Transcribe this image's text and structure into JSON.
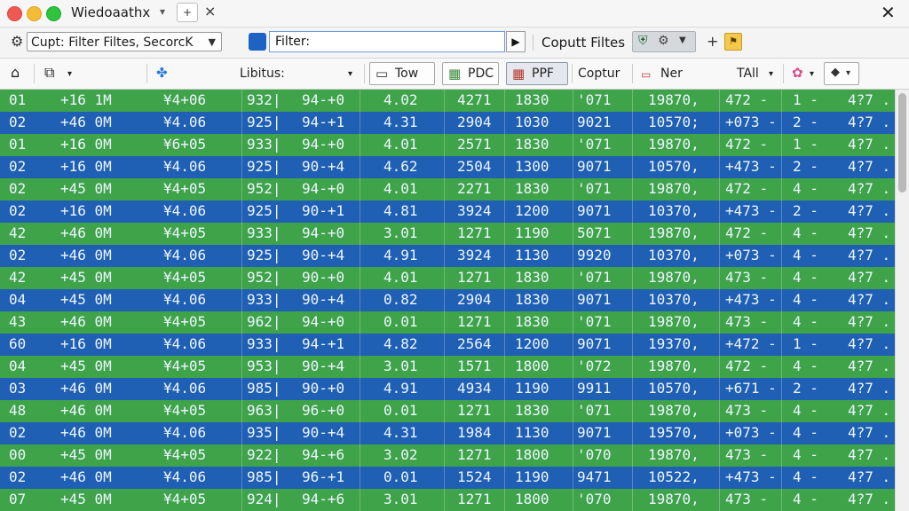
{
  "titlebar": {
    "app_title": "Wiedoaathx",
    "tab_caret": "▾",
    "tab_add": "+",
    "tab_close": "×",
    "window_close": "✕"
  },
  "filterbar": {
    "preset_value": "Cupt: Filter Filtes, SecorcK",
    "filter_value": "Filter:",
    "go_glyph": "▶",
    "output_label": "Coputt Filtes",
    "plus_glyph": "+",
    "star_glyph": "⚑"
  },
  "columns": {
    "home": "⌂",
    "copy": "⧉",
    "listus": "Libitus:",
    "tow": "Tow",
    "pdc": "PDC",
    "ppf": "PPF",
    "coptur": "Coptur",
    "ner": "Ner",
    "tall": "TAll",
    "caret": "▾"
  },
  "rows": [
    [
      "01",
      "+16 1M",
      "¥4+06",
      "932|",
      "94-+0",
      "4.02",
      "4271",
      "1830",
      "'071",
      "19870,",
      "472 -",
      "1 -",
      "4?7 ."
    ],
    [
      "02",
      "+46 0M",
      "¥4.06",
      "925|",
      "94-+1",
      "4.31",
      "2904",
      "1030",
      "9021",
      "10570;",
      "+073 -",
      "2 -",
      "4?7 ."
    ],
    [
      "01",
      "+16 0M",
      "¥6+05",
      "933|",
      "94-+0",
      "4.01",
      "2571",
      "1830",
      "'071",
      "19870,",
      "472 -",
      "1 -",
      "4?7 ."
    ],
    [
      "02",
      "+16 0M",
      "¥4.06",
      "925|",
      "90-+4",
      "4.62",
      "2504",
      "1300",
      "9071",
      "10570,",
      "+473 -",
      "2 -",
      "4?7 ."
    ],
    [
      "02",
      "+45 0M",
      "¥4+05",
      "952|",
      "94-+0",
      "4.01",
      "2271",
      "1830",
      "'071",
      "19870,",
      "472 -",
      "4 -",
      "4?7 ."
    ],
    [
      "02",
      "+16 0M",
      "¥4.06",
      "925|",
      "90-+1",
      "4.81",
      "3924",
      "1200",
      "9071",
      "10370,",
      "+473 -",
      "2 -",
      "4?7 ."
    ],
    [
      "42",
      "+46 0M",
      "¥4+05",
      "933|",
      "94-+0",
      "3.01",
      "1271",
      "1190",
      "5071",
      "19870,",
      "472 -",
      "4 -",
      "4?7 ."
    ],
    [
      "02",
      "+46 0M",
      "¥4.06",
      "925|",
      "90-+4",
      "4.91",
      "3924",
      "1130",
      "9920",
      "10370,",
      "+073 -",
      "4 -",
      "4?7 ."
    ],
    [
      "42",
      "+45 0M",
      "¥4+05",
      "952|",
      "90-+0",
      "4.01",
      "1271",
      "1830",
      "'071",
      "19870,",
      "473 -",
      "4 -",
      "4?7 ."
    ],
    [
      "04",
      "+45 0M",
      "¥4.06",
      "933|",
      "90-+4",
      "0.82",
      "2904",
      "1830",
      "9071",
      "10370,",
      "+473 -",
      "4 -",
      "4?7 ."
    ],
    [
      "43",
      "+46 0M",
      "¥4+05",
      "962|",
      "94-+0",
      "0.01",
      "1271",
      "1830",
      "'071",
      "19870,",
      "473 -",
      "4 -",
      "4?7 ."
    ],
    [
      "60",
      "+16 0M",
      "¥4.06",
      "933|",
      "94-+1",
      "4.82",
      "2564",
      "1200",
      "9071",
      "19370,",
      "+472 -",
      "1 -",
      "4?7 ."
    ],
    [
      "04",
      "+45 0M",
      "¥4+05",
      "953|",
      "90-+4",
      "3.01",
      "1571",
      "1800",
      "'072",
      "19870,",
      "472 -",
      "4 -",
      "4?7 ."
    ],
    [
      "03",
      "+46 0M",
      "¥4.06",
      "985|",
      "90-+0",
      "4.91",
      "4934",
      "1190",
      "9911",
      "10570,",
      "+671 -",
      "2 -",
      "4?7 ."
    ],
    [
      "48",
      "+46 0M",
      "¥4+05",
      "963|",
      "96-+0",
      "0.01",
      "1271",
      "1830",
      "'071",
      "19870,",
      "473 -",
      "4 -",
      "4?7 ."
    ],
    [
      "02",
      "+46 0M",
      "¥4.06",
      "935|",
      "90-+4",
      "4.31",
      "1984",
      "1130",
      "9071",
      "19570,",
      "+073 -",
      "4 -",
      "4?7 ."
    ],
    [
      "00",
      "+45 0M",
      "¥4+05",
      "922|",
      "94-+6",
      "3.02",
      "1271",
      "1800",
      "'070",
      "19870,",
      "473 -",
      "4 -",
      "4?7 ."
    ],
    [
      "02",
      "+46 0M",
      "¥4.06",
      "985|",
      "96-+1",
      "0.01",
      "1524",
      "1190",
      "9471",
      "10522,",
      "+473 -",
      "4 -",
      "4?7 ."
    ],
    [
      "07",
      "+45 0M",
      "¥4+05",
      "924|",
      "94-+6",
      "3.01",
      "1271",
      "1800",
      "'070",
      "19870,",
      "473 -",
      "4 -",
      "4?7 ."
    ]
  ],
  "colors": {
    "row_green": "#3fa34a",
    "row_blue": "#1f5fb4",
    "accent": "#1d63c4"
  }
}
